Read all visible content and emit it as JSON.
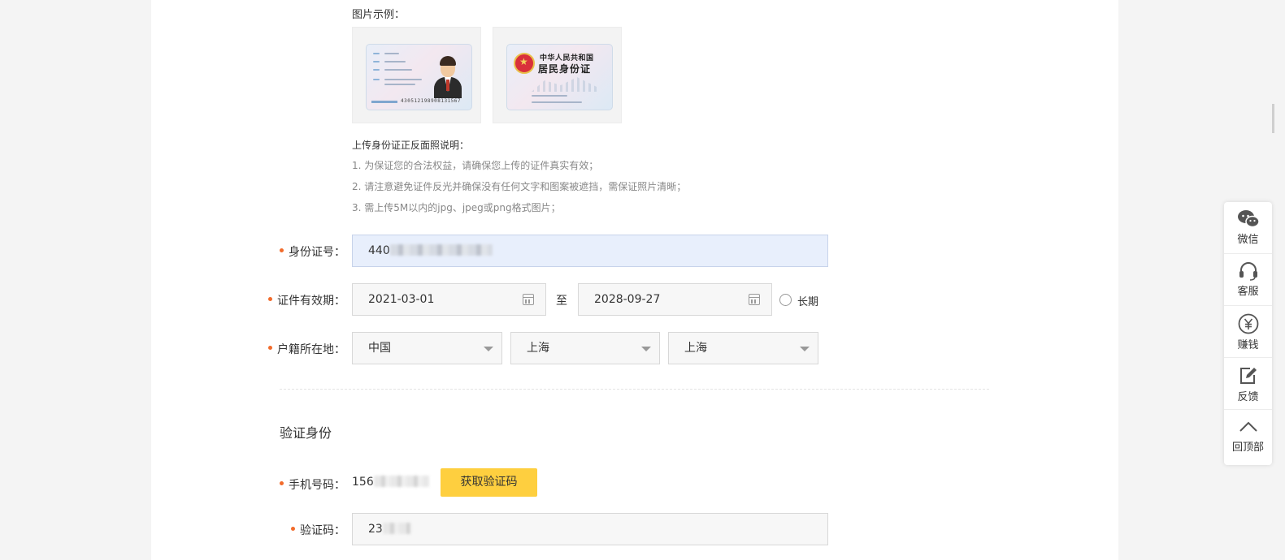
{
  "example": {
    "label": "图片示例：",
    "front_card": {
      "id_number": "430512198908131567"
    },
    "back_card": {
      "title_line1": "中华人民共和国",
      "title_line2": "居民身份证"
    }
  },
  "instructions": {
    "title": "上传身份证正反面照说明：",
    "items": [
      "1. 为保证您的合法权益，请确保您上传的证件真实有效；",
      "2. 请注意避免证件反光并确保没有任何文字和图案被遮挡，需保证照片清晰；",
      "3. 需上传5M以内的jpg、jpeg或png格式图片；"
    ]
  },
  "id_field": {
    "label": "身份证号：",
    "value_visible": "440"
  },
  "validity": {
    "label": "证件有效期：",
    "start": "2021-03-01",
    "separator": "至",
    "end": "2028-09-27",
    "long_term_label": "长期"
  },
  "residence": {
    "label": "户籍所在地：",
    "country": "中国",
    "province": "上海",
    "city": "上海"
  },
  "verify": {
    "section_title": "验证身份",
    "phone_label": "手机号码：",
    "phone_visible": "156",
    "get_code_button": "获取验证码",
    "code_label": "验证码：",
    "code_visible": "23"
  },
  "sidebar": {
    "items": [
      {
        "label": "微信",
        "icon": "wechat-icon"
      },
      {
        "label": "客服",
        "icon": "headset-icon"
      },
      {
        "label": "赚钱",
        "icon": "yuan-icon"
      },
      {
        "label": "反馈",
        "icon": "edit-icon"
      },
      {
        "label": "回顶部",
        "icon": "chevron-up-icon"
      }
    ]
  },
  "colors": {
    "accent_button": "#fecf3f",
    "required_dot": "#f26b2b",
    "highlight_input": "#e8effc"
  }
}
